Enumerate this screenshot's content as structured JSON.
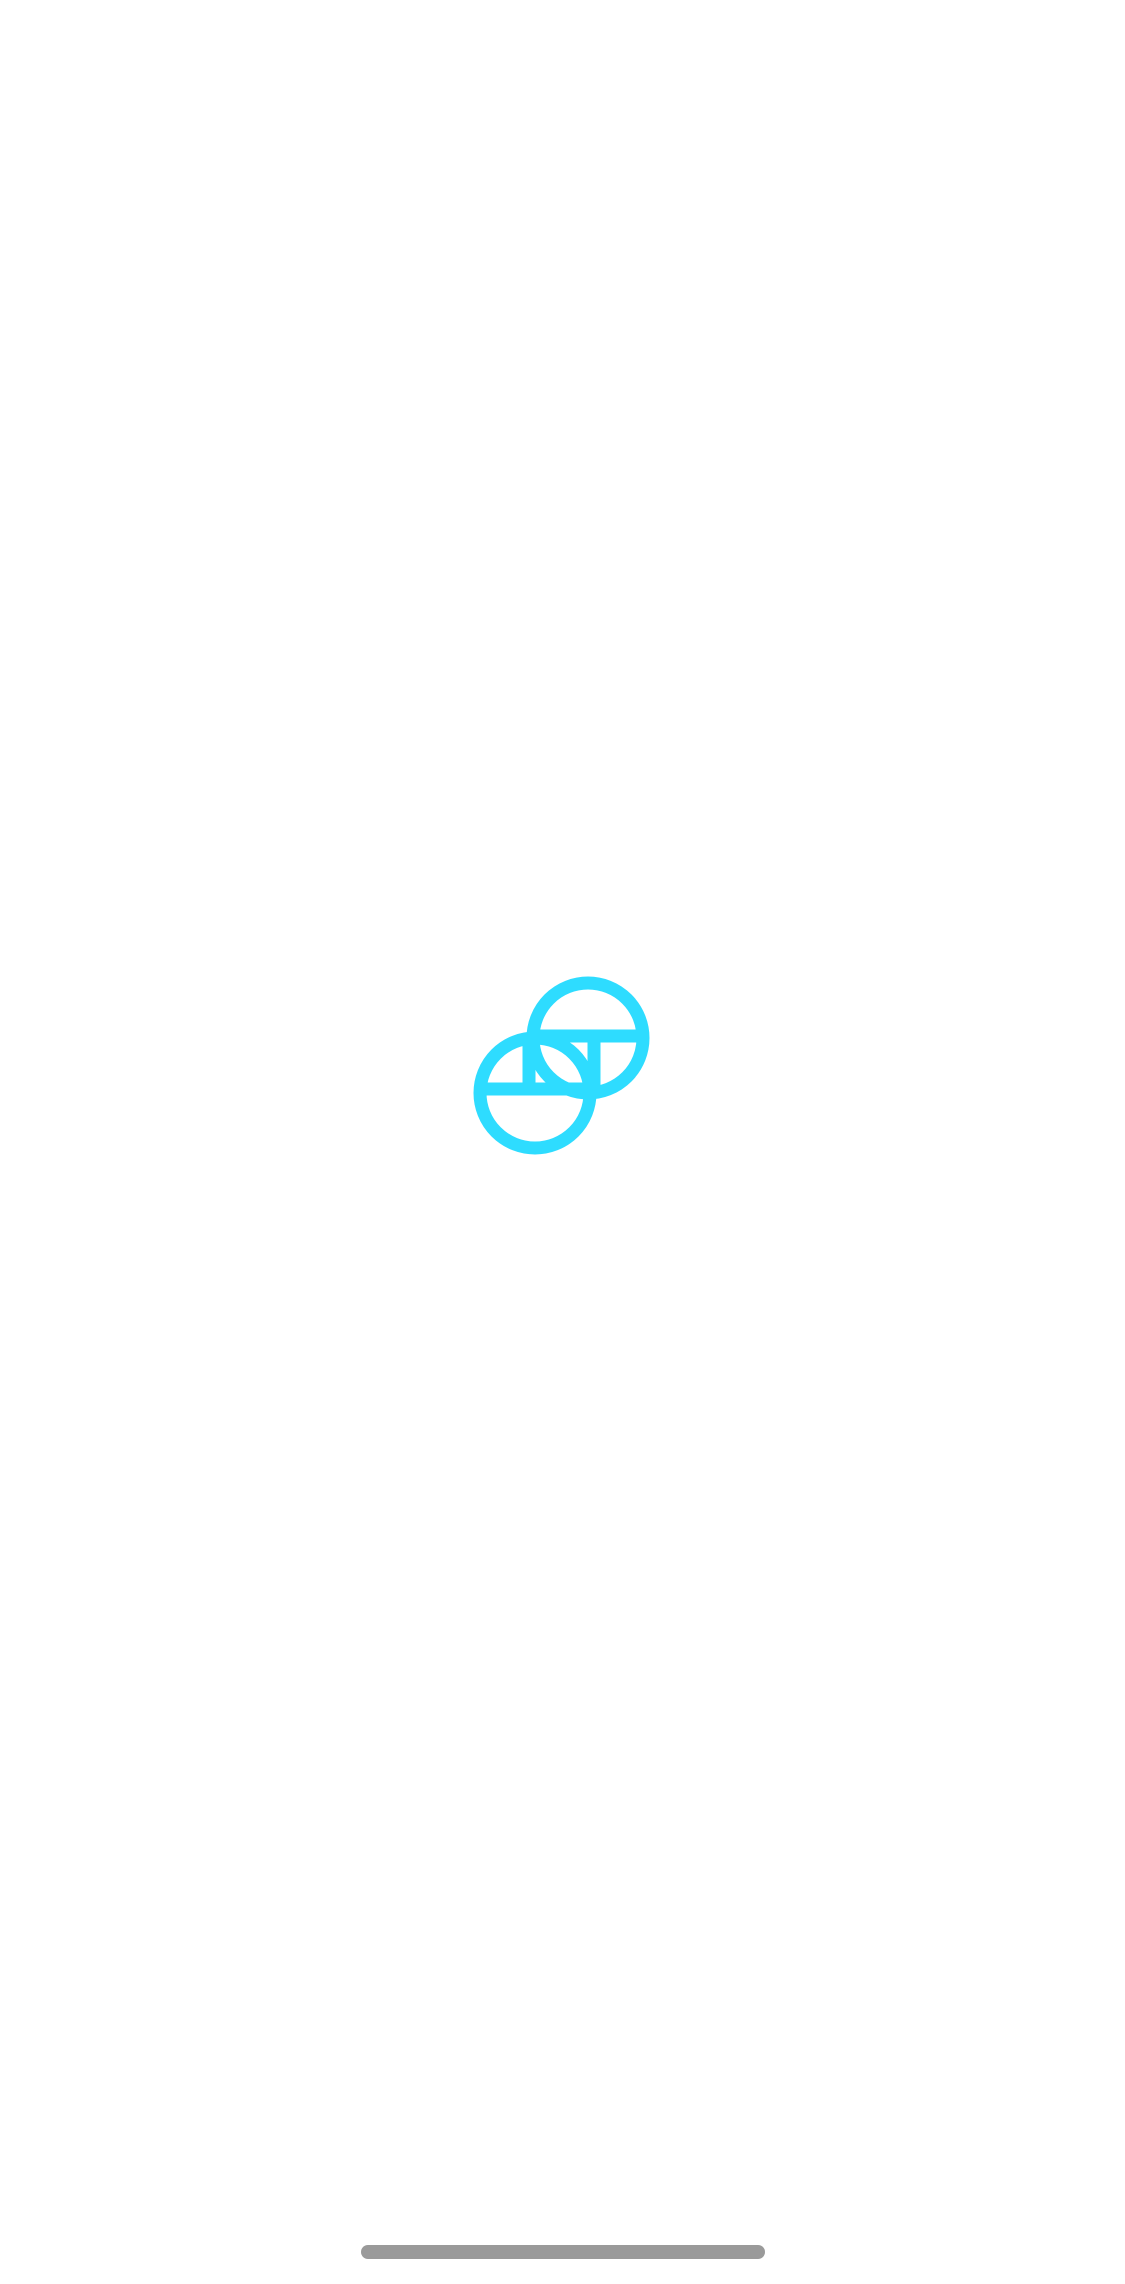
{
  "splash": {
    "logo_icon": "gemini-logo-icon",
    "logo_color": "#2edcff",
    "background_color": "#ffffff"
  },
  "system": {
    "home_indicator_color": "#9a9a9a"
  }
}
